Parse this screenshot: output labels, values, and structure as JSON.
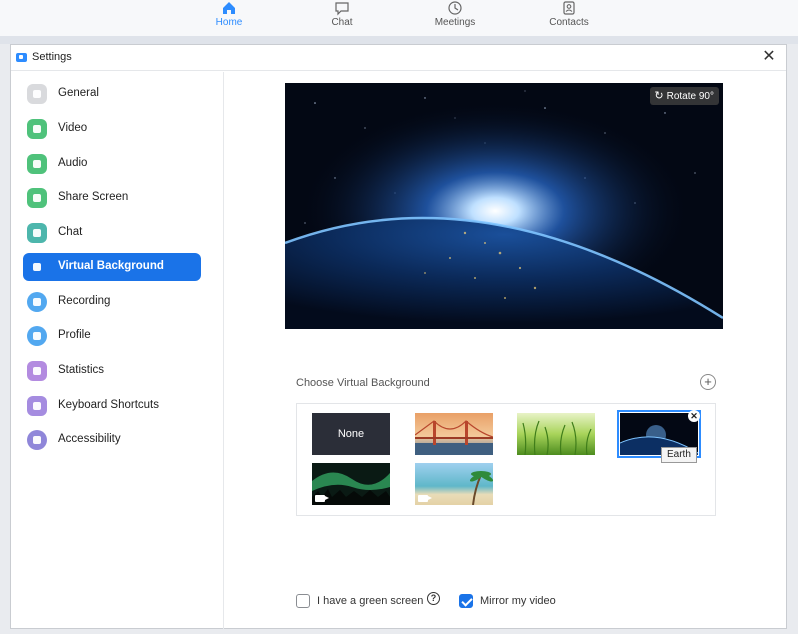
{
  "nav": {
    "items": [
      {
        "label": "Home",
        "icon": "home-icon",
        "active": true
      },
      {
        "label": "Chat",
        "icon": "chat-icon",
        "active": false
      },
      {
        "label": "Meetings",
        "icon": "clock-icon",
        "active": false
      },
      {
        "label": "Contacts",
        "icon": "contacts-icon",
        "active": false
      }
    ]
  },
  "window": {
    "title": "Settings",
    "close_glyph": "✕"
  },
  "sidebar": {
    "items": [
      {
        "label": "General",
        "icon": "gear-icon",
        "color": "#d9dadd"
      },
      {
        "label": "Video",
        "icon": "video-icon",
        "color": "#4fc27b"
      },
      {
        "label": "Audio",
        "icon": "headphones-icon",
        "color": "#4fc27b"
      },
      {
        "label": "Share Screen",
        "icon": "share-screen-icon",
        "color": "#4fc27b"
      },
      {
        "label": "Chat",
        "icon": "chat-icon",
        "color": "#4db6ac"
      },
      {
        "label": "Virtual Background",
        "icon": "person-card-icon",
        "color": "#1a73e8",
        "active": true
      },
      {
        "label": "Recording",
        "icon": "record-icon",
        "color": "#52a8f0"
      },
      {
        "label": "Profile",
        "icon": "profile-icon",
        "color": "#52a8f0"
      },
      {
        "label": "Statistics",
        "icon": "bar-chart-icon",
        "color": "#b38be0"
      },
      {
        "label": "Keyboard Shortcuts",
        "icon": "keyboard-icon",
        "color": "#a58ce0"
      },
      {
        "label": "Accessibility",
        "icon": "accessibility-icon",
        "color": "#8f86d9"
      }
    ]
  },
  "main": {
    "rotate_label": "Rotate 90°",
    "choose_label": "Choose Virtual Background",
    "add_glyph": "+",
    "backgrounds": [
      {
        "label": "None",
        "kind": "none"
      },
      {
        "kind": "golden-gate",
        "label": ""
      },
      {
        "kind": "grass",
        "label": ""
      },
      {
        "kind": "earth",
        "label": "Earth",
        "selected": true
      },
      {
        "kind": "aurora",
        "label": "",
        "video": true
      },
      {
        "kind": "beach",
        "label": "",
        "video": true
      }
    ],
    "tooltip": "Earth",
    "green_screen": {
      "label": "I have a green screen",
      "checked": false,
      "help": "?"
    },
    "mirror": {
      "label": "Mirror my video",
      "checked": true
    }
  },
  "colors": {
    "accent": "#1a73e8",
    "zoom_blue": "#2d8cff"
  }
}
